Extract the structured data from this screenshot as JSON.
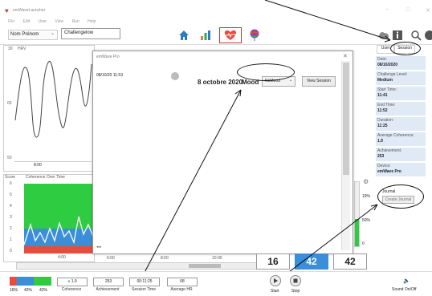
{
  "window": {
    "title": "emWaveLauncher",
    "controls": [
      "−",
      "□",
      "✕"
    ]
  },
  "menu": [
    "File",
    "Edit",
    "User",
    "View",
    "Run",
    "Help"
  ],
  "toolbar": {
    "user_select": "Nom Prénom",
    "user_value": "Challengelow"
  },
  "sidepanel": {
    "tabs": [
      "User",
      "Session"
    ],
    "fields": [
      {
        "label": "Date:",
        "value": "08/10/2020"
      },
      {
        "label": "Challenge Level:",
        "value": "Medium"
      },
      {
        "label": "Start Time:",
        "value": "11:41"
      },
      {
        "label": "End Time:",
        "value": "11:52"
      },
      {
        "label": "Duration:",
        "value": "11:25"
      },
      {
        "label": "Average Coherence:",
        "value": "1.9"
      },
      {
        "label": "Achievement:",
        "value": "253"
      },
      {
        "label": "Device:",
        "value": "emWave Pro"
      }
    ],
    "journal_label": "Journal",
    "journal_button": "Create Journal"
  },
  "hrv": {
    "label": "HRV",
    "y_top": "30",
    "y_mid": "65",
    "y_bottom": "50",
    "x_tick": "8:00"
  },
  "coherence": {
    "title_prefix": "Score",
    "title": "Coherence Over Time",
    "y_ticks": [
      "6",
      "5",
      "4",
      "3",
      "2",
      "1",
      "0"
    ],
    "x_ticks": [
      "4:00",
      "6:00",
      "8:00",
      "10:00"
    ],
    "pct_labels": [
      "19%",
      "50%",
      "0"
    ]
  },
  "modal": {
    "title": "emWave Pro",
    "date_time": "08/10/20     11:53",
    "date_label": "8 octobre 2020",
    "mood_label": "Mood",
    "mood_value": "NoMood",
    "view_button": "View Session"
  },
  "scores": [
    "16",
    "42",
    "42"
  ],
  "status": {
    "pct": [
      "16%",
      "42%",
      "42%"
    ],
    "coherence_val": "1.9",
    "coherence_cap": "Coherence",
    "achievement_val": "253",
    "achievement_cap": "Achievement",
    "session_time_val": "00:11:25",
    "session_time_cap": "Session Time",
    "avg_hr_val": "68",
    "avg_hr_cap": "Average HR",
    "start": "Start",
    "stop": "Stop",
    "sound": "Sound On/Off"
  }
}
